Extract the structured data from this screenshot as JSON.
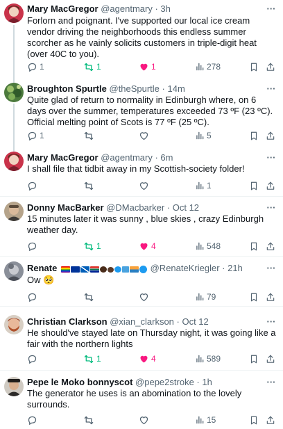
{
  "tweets": [
    {
      "name": "Mary MacGregor",
      "handle": "@agentmary",
      "time": "· 3h",
      "text": "Forlorn and poignant. I've supported our local ice cream vendor driving the neighborhoods this endless summer scorcher as he vainly solicits customers in triple-digit heat (over 40C to you).",
      "replies": "1",
      "retweets": "1",
      "likes": "1",
      "views": "278",
      "retweeted": true,
      "liked": true
    },
    {
      "name": "Broughton Spurtle",
      "handle": "@theSpurtle",
      "time": "· 14m",
      "text": "Quite glad of return to normality in Edinburgh where, on 6 days over the summer, temperatures exceeded 73 ºF (23 ºC). Official melting point of Scots is 77 ºF (25 ºC).",
      "replies": "1",
      "retweets": "",
      "likes": "",
      "views": "5",
      "retweeted": false,
      "liked": false
    },
    {
      "name": "Mary MacGregor",
      "handle": "@agentmary",
      "time": "· 6m",
      "text": "I shall file that tidbit away in my Scottish-society folder!",
      "replies": "",
      "retweets": "",
      "likes": "",
      "views": "1",
      "retweeted": false,
      "liked": false
    },
    {
      "name": "Donny MacBarker",
      "handle": "@DMacbarker",
      "time": "· Oct 12",
      "text": "15 minutes later it was sunny , blue skies , crazy Edinburgh weather day.",
      "replies": "",
      "retweets": "1",
      "likes": "4",
      "views": "548",
      "retweeted": true,
      "liked": true
    },
    {
      "name": "Renate",
      "handle": "@RenateKriegler",
      "time": "· 21h",
      "name_emoji": "🏳️‍🌈🇪🇺🏴🇿🇦✊🏿🐾💙🎶🌅✅",
      "text": "Ow 🥺",
      "replies": "",
      "retweets": "",
      "likes": "",
      "views": "79",
      "retweeted": false,
      "liked": false
    },
    {
      "name": "Christian Clarkson",
      "handle": "@xian_clarkson",
      "time": "· Oct 12",
      "text": "He should've stayed late on Thursday night, it was going like a fair with the northern lights",
      "replies": "",
      "retweets": "1",
      "likes": "4",
      "views": "589",
      "retweeted": true,
      "liked": true
    },
    {
      "name": "Pepe le Moko bonnyscot",
      "handle": "@pepe2stroke",
      "time": "· 1h",
      "text": "The generator he uses is an abomination to the lovely surrounds.",
      "replies": "",
      "retweets": "",
      "likes": "",
      "views": "15",
      "retweeted": false,
      "liked": false
    }
  ],
  "colors": {
    "text": "#0f1419",
    "secondary": "#536471",
    "retweet_active": "#00ba7c",
    "like_active": "#f91880",
    "divider": "#eff3f4"
  },
  "icons": [
    "reply-icon",
    "retweet-icon",
    "like-icon",
    "views-icon",
    "bookmark-icon",
    "share-icon",
    "more-icon"
  ]
}
